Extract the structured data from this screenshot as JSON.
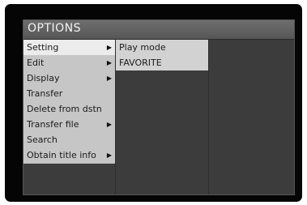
{
  "window": {
    "title": "OPTIONS"
  },
  "menu": {
    "items": [
      {
        "label": "Setting",
        "arrow": "▶",
        "selected": true
      },
      {
        "label": "Edit",
        "arrow": "▶"
      },
      {
        "label": "Display",
        "arrow": "▶"
      },
      {
        "label": "Transfer"
      },
      {
        "label": "Delete from dstn"
      },
      {
        "label": "Transfer file",
        "arrow": "▶"
      },
      {
        "label": "Search"
      },
      {
        "label": "Obtain title info",
        "arrow": "▶"
      }
    ]
  },
  "submenu": {
    "items": [
      {
        "label": "Play mode"
      },
      {
        "label": "FAVORITE"
      }
    ]
  },
  "colors": {
    "bezel": "#050505",
    "panel": "#3c3c3c",
    "menu_bg": "#c6c6c6",
    "selected_bg": "#ececec",
    "submenu_bg": "#d2d2d2"
  }
}
